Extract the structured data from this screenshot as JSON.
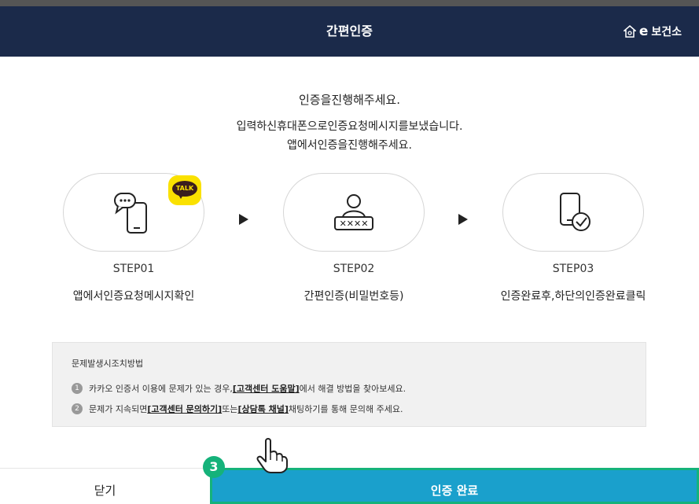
{
  "header": {
    "title": "간편인증",
    "logo_text": "보건소",
    "logo_prefix": "e"
  },
  "intro": {
    "line1": "인증을진행해주세요.",
    "line2": "입력하신휴대폰으로인증요청메시지를보냈습니다.",
    "line3": "앱에서인증을진행해주세요."
  },
  "steps": [
    {
      "label": "STEP01",
      "desc": "앱에서인증요청메시지확인",
      "icon": "phone-chat-icon"
    },
    {
      "label": "STEP02",
      "desc": "간편인증(비밀번호등)",
      "icon": "user-password-icon"
    },
    {
      "label": "STEP03",
      "desc": "인증완료후,하단의인증완료클릭",
      "icon": "phone-check-icon"
    }
  ],
  "talk_badge": "TALK",
  "help": {
    "title": "문제발생시조치방법",
    "item1_num": "1",
    "item1_pre": "카카오 인증서 이용에 문제가 있는 경우, ",
    "item1_link": "[고객센터 도움말]",
    "item1_post": " 에서 해결 방법을 찾아보세요.",
    "item2_num": "2",
    "item2_pre": "문제가 지속되면 ",
    "item2_link1": "[고객센터 문의하기]",
    "item2_mid": " 또는 ",
    "item2_link2": "[상담톡 채널]",
    "item2_post": " 채팅하기를 통해 문의해 주세요."
  },
  "footer": {
    "close_label": "닫기",
    "complete_label": "인증 완료"
  },
  "annotation": {
    "step_badge": "3"
  },
  "colors": {
    "header_bg": "#1b2a4a",
    "complete_bg": "#1aa0cc",
    "highlight": "#15b27a",
    "kakao_yellow": "#fae100"
  }
}
